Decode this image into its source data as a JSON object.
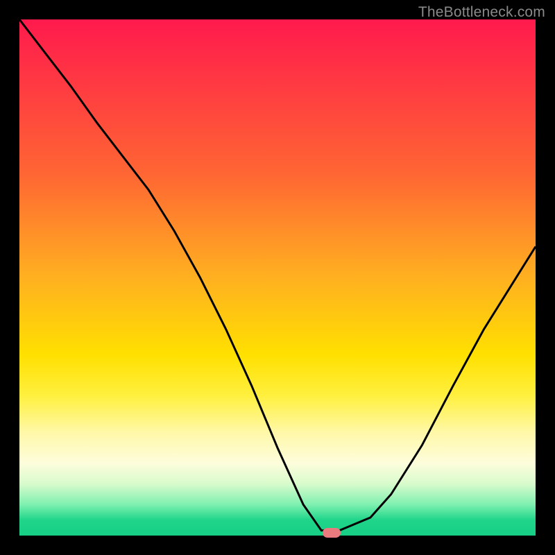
{
  "attribution": "TheBottleneck.com",
  "chart_data": {
    "type": "line",
    "title": "",
    "xlabel": "",
    "ylabel": "",
    "xlim": [
      0,
      1
    ],
    "ylim": [
      0,
      1
    ],
    "grid": false,
    "curve": {
      "x": [
        0.0,
        0.05,
        0.1,
        0.15,
        0.2,
        0.25,
        0.3,
        0.35,
        0.4,
        0.45,
        0.5,
        0.55,
        0.585,
        0.62,
        0.68,
        0.72,
        0.78,
        0.84,
        0.9,
        0.95,
        1.0
      ],
      "y": [
        1.0,
        0.935,
        0.87,
        0.8,
        0.735,
        0.67,
        0.59,
        0.5,
        0.4,
        0.29,
        0.17,
        0.06,
        0.01,
        0.01,
        0.035,
        0.08,
        0.175,
        0.29,
        0.4,
        0.48,
        0.56
      ]
    },
    "marker": {
      "x": 0.605,
      "y": 0.005,
      "color": "#e97a7e"
    },
    "gradient_stops": [
      {
        "pos": 0.0,
        "color": "#ff1a4d"
      },
      {
        "pos": 0.3,
        "color": "#ff6633"
      },
      {
        "pos": 0.5,
        "color": "#ffb020"
      },
      {
        "pos": 0.73,
        "color": "#fff040"
      },
      {
        "pos": 0.9,
        "color": "#d8fbcc"
      },
      {
        "pos": 1.0,
        "color": "#16cf85"
      }
    ]
  }
}
